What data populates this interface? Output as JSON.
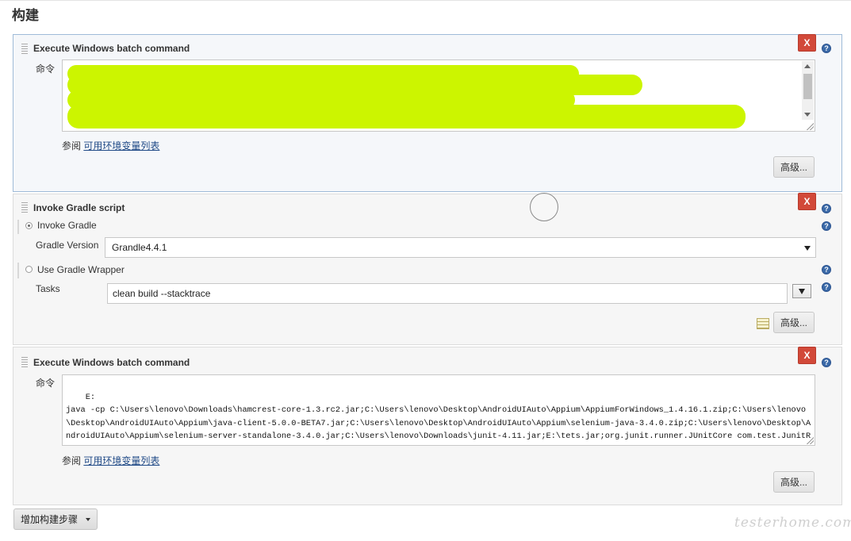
{
  "section_title": "构建",
  "steps": [
    {
      "title": "Execute Windows batch command",
      "delete_label": "X",
      "command_label": "命令",
      "command_text": "",
      "see_also_prefix": "参阅",
      "env_link": "可用环境变量列表",
      "advanced_label": "高级..."
    },
    {
      "title": "Invoke Gradle script",
      "delete_label": "X",
      "invoke_gradle_label": "Invoke Gradle",
      "gradle_version_label": "Gradle Version",
      "gradle_version_value": "Grandle4.4.1",
      "use_wrapper_label": "Use Gradle Wrapper",
      "tasks_label": "Tasks",
      "tasks_value": "clean build --stacktrace",
      "advanced_label": "高级..."
    },
    {
      "title": "Execute Windows batch command",
      "delete_label": "X",
      "command_label": "命令",
      "command_text": "E:\njava -cp C:\\Users\\lenovo\\Downloads\\hamcrest-core-1.3.rc2.jar;C:\\Users\\lenovo\\Desktop\\AndroidUIAuto\\Appium\\AppiumForWindows_1.4.16.1.zip;C:\\Users\\lenovo\\Desktop\\AndroidUIAuto\\Appium\\java-client-5.0.0-BETA7.jar;C:\\Users\\lenovo\\Desktop\\AndroidUIAuto\\Appium\\selenium-java-3.4.0.zip;C:\\Users\\lenovo\\Desktop\\AndroidUIAuto\\Appium\\selenium-server-standalone-3.4.0.jar;C:\\Users\\lenovo\\Downloads\\junit-4.11.jar;E:\\tets.jar;org.junit.runner.JUnitCore com.test.JunitRunner",
      "see_also_prefix": "参阅",
      "env_link": "可用环境变量列表",
      "advanced_label": "高级..."
    }
  ],
  "add_step_label": "增加构建步骤",
  "help_glyph": "?",
  "watermark": "testerhome.com",
  "colors": {
    "delete": "#d24939",
    "link": "#204a87",
    "redaction": "#ccf500",
    "help": "#3b6aa8"
  }
}
